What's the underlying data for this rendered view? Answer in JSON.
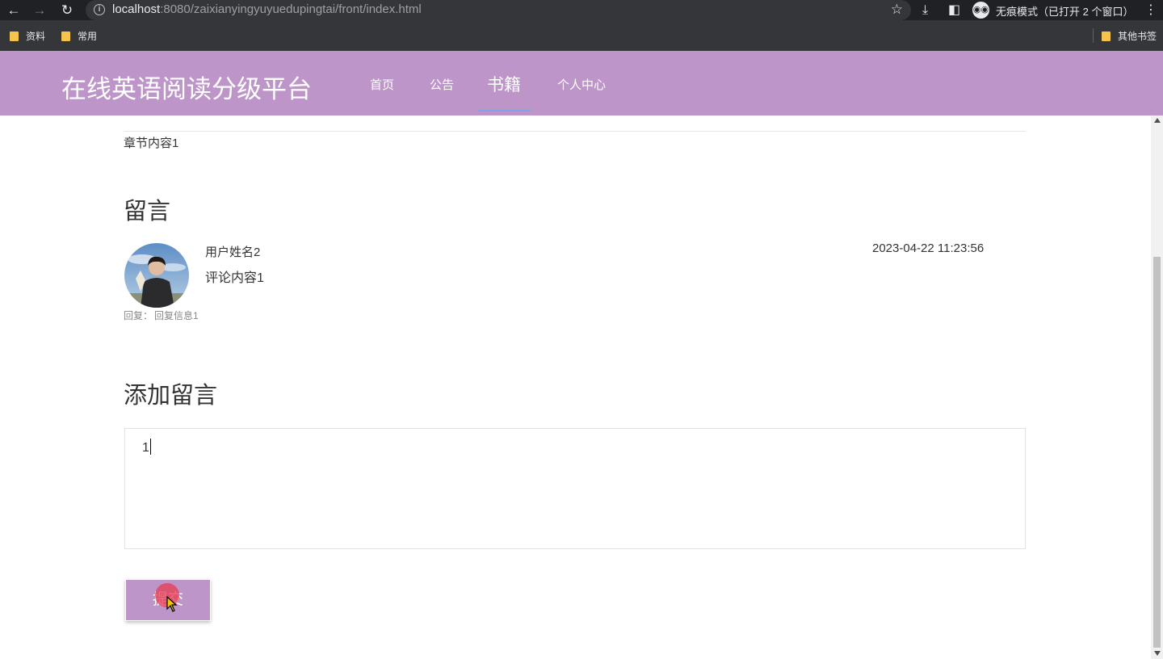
{
  "browser": {
    "url_host": "localhost",
    "url_path": ":8080/zaixianyingyuyuedupingtai/front/index.html",
    "incognito_label": "无痕模式（已打开 2 个窗口）",
    "bookmarks": [
      "资料",
      "常用"
    ],
    "other_bookmarks": "其他书签"
  },
  "site": {
    "title": "在线英语阅读分级平台",
    "nav": [
      "首页",
      "公告",
      "书籍",
      "个人中心"
    ],
    "active_nav": "书籍",
    "brand_color": "#bd95c8"
  },
  "content": {
    "chapter_text": "章节内容1",
    "comments_heading": "留言",
    "comment": {
      "username": "用户姓名2",
      "text": "评论内容1",
      "timestamp": "2023-04-22 11:23:56",
      "reply_label": "回复：",
      "reply_text": "回复信息1"
    },
    "add_heading": "添加留言",
    "textarea_value": "1",
    "submit_label": "提交"
  }
}
